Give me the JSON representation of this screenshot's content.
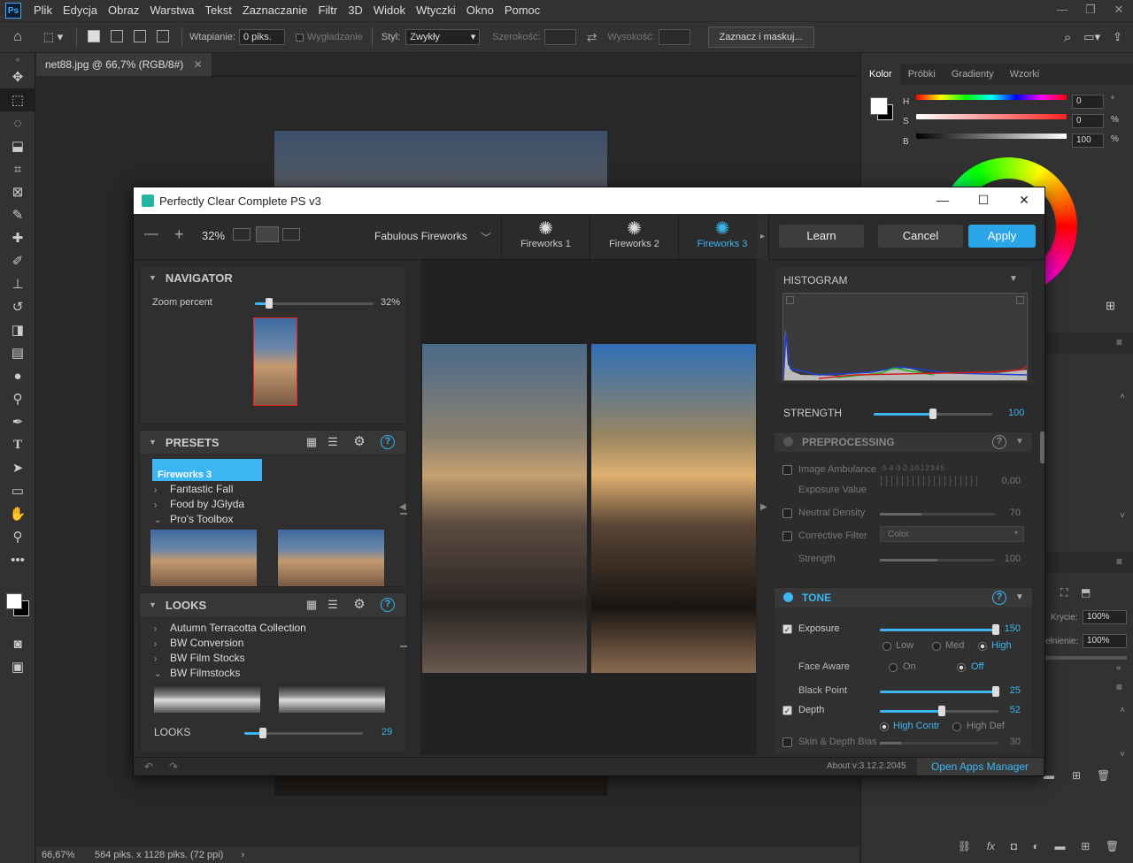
{
  "menubar": {
    "app_icon": "Ps",
    "items": [
      "Plik",
      "Edycja",
      "Obraz",
      "Warstwa",
      "Tekst",
      "Zaznaczanie",
      "Filtr",
      "3D",
      "Widok",
      "Wtyczki",
      "Okno",
      "Pomoc"
    ]
  },
  "options": {
    "feather_label": "Wtapianie:",
    "feather_value": "0 piks.",
    "antialias_label": "Wygładzanie",
    "style_label": "Styl:",
    "style_value": "Zwykły",
    "width_label": "Szerokość:",
    "height_label": "Wysokość:",
    "mask_button": "Zaznacz i maskuj..."
  },
  "document": {
    "tab_title": "net88.jpg @ 66,7% (RGB/8#)",
    "zoom": "66,67%",
    "info": "564 piks. x 1128 piks. (72 ppi)"
  },
  "right_panel": {
    "tabs": [
      "Kolor",
      "Próbki",
      "Gradienty",
      "Wzorki"
    ],
    "h_label": "H",
    "h_value": "0",
    "h_unit": "°",
    "s_label": "S",
    "s_value": "0",
    "s_unit": "%",
    "b_label": "B",
    "b_value": "100",
    "b_unit": "%",
    "krycie_label": "Krycie:",
    "krycie_value": "100%",
    "wypelnienie_label": "ełnienie:",
    "wypelnienie_value": "100%"
  },
  "plugin": {
    "title": "Perfectly Clear Complete PS v3",
    "zoom_level": "32%",
    "preset_group": "Fabulous Fireworks",
    "preset_tabs": [
      {
        "label": "Fireworks 1"
      },
      {
        "label": "Fireworks 2"
      },
      {
        "label": "Fireworks 3"
      }
    ],
    "learn_button": "Learn",
    "cancel_button": "Cancel",
    "apply_button": "Apply",
    "navigator": {
      "header": "NAVIGATOR",
      "zoom_label": "Zoom percent",
      "zoom_value": "32%",
      "zoom_fraction": 0.12
    },
    "presets": {
      "header": "PRESETS",
      "selected": "Fireworks 3",
      "items": [
        "Fantastic Fall",
        "Food by JGlyda",
        "Pro's Toolbox"
      ]
    },
    "looks": {
      "header": "LOOKS",
      "items": [
        "Autumn Terracotta Collection",
        "BW Conversion",
        "BW Film Stocks",
        "BW Filmstocks"
      ],
      "strength_label": "LOOKS",
      "strength_value": "29",
      "strength_fraction": 0.16
    },
    "histogram": {
      "header": "HISTOGRAM"
    },
    "strength": {
      "label": "STRENGTH",
      "value": "100",
      "fraction": 0.5
    },
    "preprocessing": {
      "header": "PREPROCESSING",
      "image_ambulance": "Image Ambulance",
      "ambulance_scale": "-5 -4 -3 -2 -1 0 1 2 3 4 5",
      "exposure_value_label": "Exposure Value",
      "exposure_value": "0,00",
      "neutral_density": "Neutral Density",
      "neutral_density_value": "70",
      "corrective_filter": "Corrective Filter",
      "corrective_filter_value": "Color",
      "strength_label": "Strength",
      "strength_value": "100"
    },
    "tone": {
      "header": "TONE",
      "exposure_label": "Exposure",
      "exposure_value": "150",
      "exposure_modes": [
        "Low",
        "Med",
        "High"
      ],
      "face_aware_label": "Face Aware",
      "face_aware_options": [
        "On",
        "Off"
      ],
      "black_point_label": "Black Point",
      "black_point_value": "25",
      "depth_label": "Depth",
      "depth_value": "52",
      "depth_modes": [
        "High Contr",
        "High Def"
      ],
      "skin_depth_label": "Skin & Depth Bias",
      "skin_depth_value": "30"
    },
    "footer": {
      "about": "About v:3.12.2.2045",
      "apps_manager": "Open Apps Manager"
    }
  },
  "colors": {
    "accent": "#3db5f0",
    "apply": "#2aa5e8",
    "ps_bg": "#323232"
  }
}
